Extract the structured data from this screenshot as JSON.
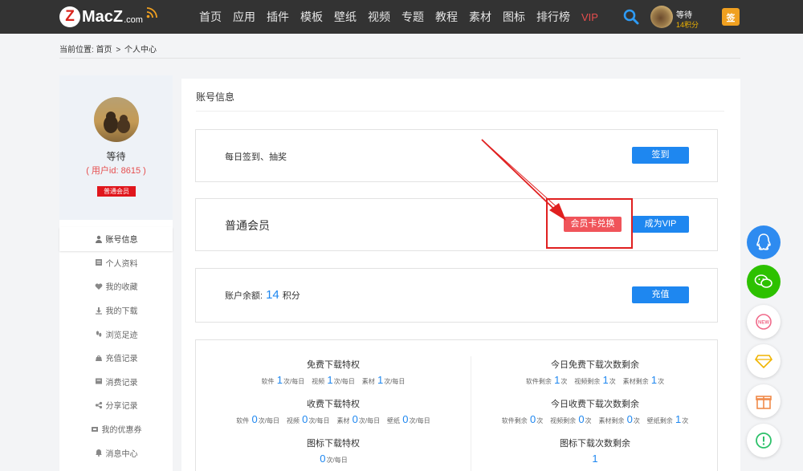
{
  "header": {
    "logo_letter": "Z",
    "logo_text": "MacZ",
    "logo_suffix": ".com",
    "nav": [
      "首页",
      "应用",
      "插件",
      "模板",
      "壁纸",
      "视频",
      "专题",
      "教程",
      "素材",
      "图标",
      "排行榜"
    ],
    "nav_vip": "VIP",
    "user_name": "等待",
    "user_points": "14积分",
    "calendar_label": "签"
  },
  "breadcrumb": {
    "prefix": "当前位置:",
    "home": "首页",
    "separator": ">",
    "current": "个人中心"
  },
  "sidebar": {
    "name": "等待",
    "uid": "( 用户id: 8615 )",
    "badge": "普通会员",
    "menu": [
      {
        "label": "账号信息",
        "icon": "user-icon"
      },
      {
        "label": "个人资料",
        "icon": "profile-icon"
      },
      {
        "label": "我的收藏",
        "icon": "heart-icon"
      },
      {
        "label": "我的下载",
        "icon": "download-icon"
      },
      {
        "label": "浏览足迹",
        "icon": "footprint-icon"
      },
      {
        "label": "充值记录",
        "icon": "recharge-icon"
      },
      {
        "label": "消费记录",
        "icon": "receipt-icon"
      },
      {
        "label": "分享记录",
        "icon": "share-icon"
      },
      {
        "label": "我的优惠券",
        "icon": "coupon-icon"
      },
      {
        "label": "消息中心",
        "icon": "bell-icon"
      }
    ]
  },
  "main": {
    "title": "账号信息",
    "checkin": {
      "label": "每日签到、抽奖",
      "button": "签到"
    },
    "membership": {
      "label": "普通会员",
      "redeem_button": "会员卡兑换",
      "vip_button": "成为VIP"
    },
    "balance": {
      "label": "账户余额:",
      "value": "14",
      "unit": "积分",
      "button": "充值"
    },
    "stats": {
      "free_title": "免费下载特权",
      "free": [
        {
          "prefix": "软件",
          "num": "1",
          "suffix": "次/每日"
        },
        {
          "prefix": "视频",
          "num": "1",
          "suffix": "次/每日"
        },
        {
          "prefix": "素材",
          "num": "1",
          "suffix": "次/每日"
        }
      ],
      "paid_title": "收费下载特权",
      "paid": [
        {
          "prefix": "软件",
          "num": "0",
          "suffix": "次/每日"
        },
        {
          "prefix": "视频",
          "num": "0",
          "suffix": "次/每日"
        },
        {
          "prefix": "素材",
          "num": "0",
          "suffix": "次/每日"
        },
        {
          "prefix": "壁纸",
          "num": "0",
          "suffix": "次/每日"
        }
      ],
      "icon_title": "图标下载特权",
      "icon_num": "0",
      "icon_suffix": "次/每日",
      "free_left_title": "今日免费下载次数剩余",
      "free_left": [
        {
          "prefix": "软件剩余",
          "num": "1",
          "suffix": "次"
        },
        {
          "prefix": "视频剩余",
          "num": "1",
          "suffix": "次"
        },
        {
          "prefix": "素材剩余",
          "num": "1",
          "suffix": "次"
        }
      ],
      "paid_left_title": "今日收费下载次数剩余",
      "paid_left": [
        {
          "prefix": "软件剩余",
          "num": "0",
          "suffix": "次"
        },
        {
          "prefix": "视频剩余",
          "num": "0",
          "suffix": "次"
        },
        {
          "prefix": "素材剩余",
          "num": "0",
          "suffix": "次"
        },
        {
          "prefix": "壁纸剩余",
          "num": "1",
          "suffix": "次"
        }
      ],
      "icon_left_title": "图标下载次数剩余",
      "icon_left_num": "1"
    }
  },
  "floating": [
    "qq-icon",
    "wechat-icon",
    "new-icon",
    "diamond-icon",
    "gift-icon",
    "feedback-icon"
  ],
  "colors": {
    "accent": "#1e87f0",
    "vip_red": "#e64d4d",
    "topbar": "#333333",
    "redeem": "#f0545a",
    "wechat": "#2dc100"
  }
}
